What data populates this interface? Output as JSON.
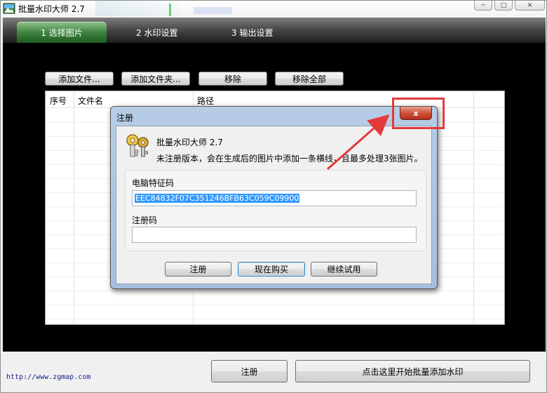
{
  "window": {
    "title": "批量水印大师 2.7",
    "controls": {
      "minimize": "─",
      "maximize": "□",
      "close": "✕"
    }
  },
  "tabs": [
    {
      "label": "1 选择图片",
      "active": true
    },
    {
      "label": "2 水印设置",
      "active": false
    },
    {
      "label": "3 输出设置",
      "active": false
    }
  ],
  "toolbar": {
    "add_file": "添加文件...",
    "add_folder": "添加文件夹...",
    "remove": "移除",
    "remove_all": "移除全部"
  },
  "table": {
    "columns": [
      "序号",
      "文件名",
      "路径"
    ],
    "rows": []
  },
  "footer": {
    "url": "http://www.zgmap.com",
    "register": "注册",
    "start": "点击这里开始批量添加水印"
  },
  "dialog": {
    "title": "注册",
    "close": "x",
    "app_name": "批量水印大师 2.7",
    "message": "未注册版本，会在生成后的图片中添加一条横线，且最多处理3张图片。",
    "machine_code_label": "电脑特征码",
    "machine_code": "EEC84832F07C351246BFB63C059C09900",
    "reg_code_label": "注册码",
    "reg_code": "",
    "buttons": {
      "register": "注册",
      "buy": "现在购买",
      "trial": "继续试用"
    }
  },
  "colors": {
    "active_tab": "#3f8540",
    "annotation": "#e23a3a",
    "selection": "#3399ff",
    "panel": "#000000"
  },
  "icons": [
    "app-icon",
    "key-icon",
    "close-icon",
    "minimize-icon",
    "maximize-icon"
  ]
}
